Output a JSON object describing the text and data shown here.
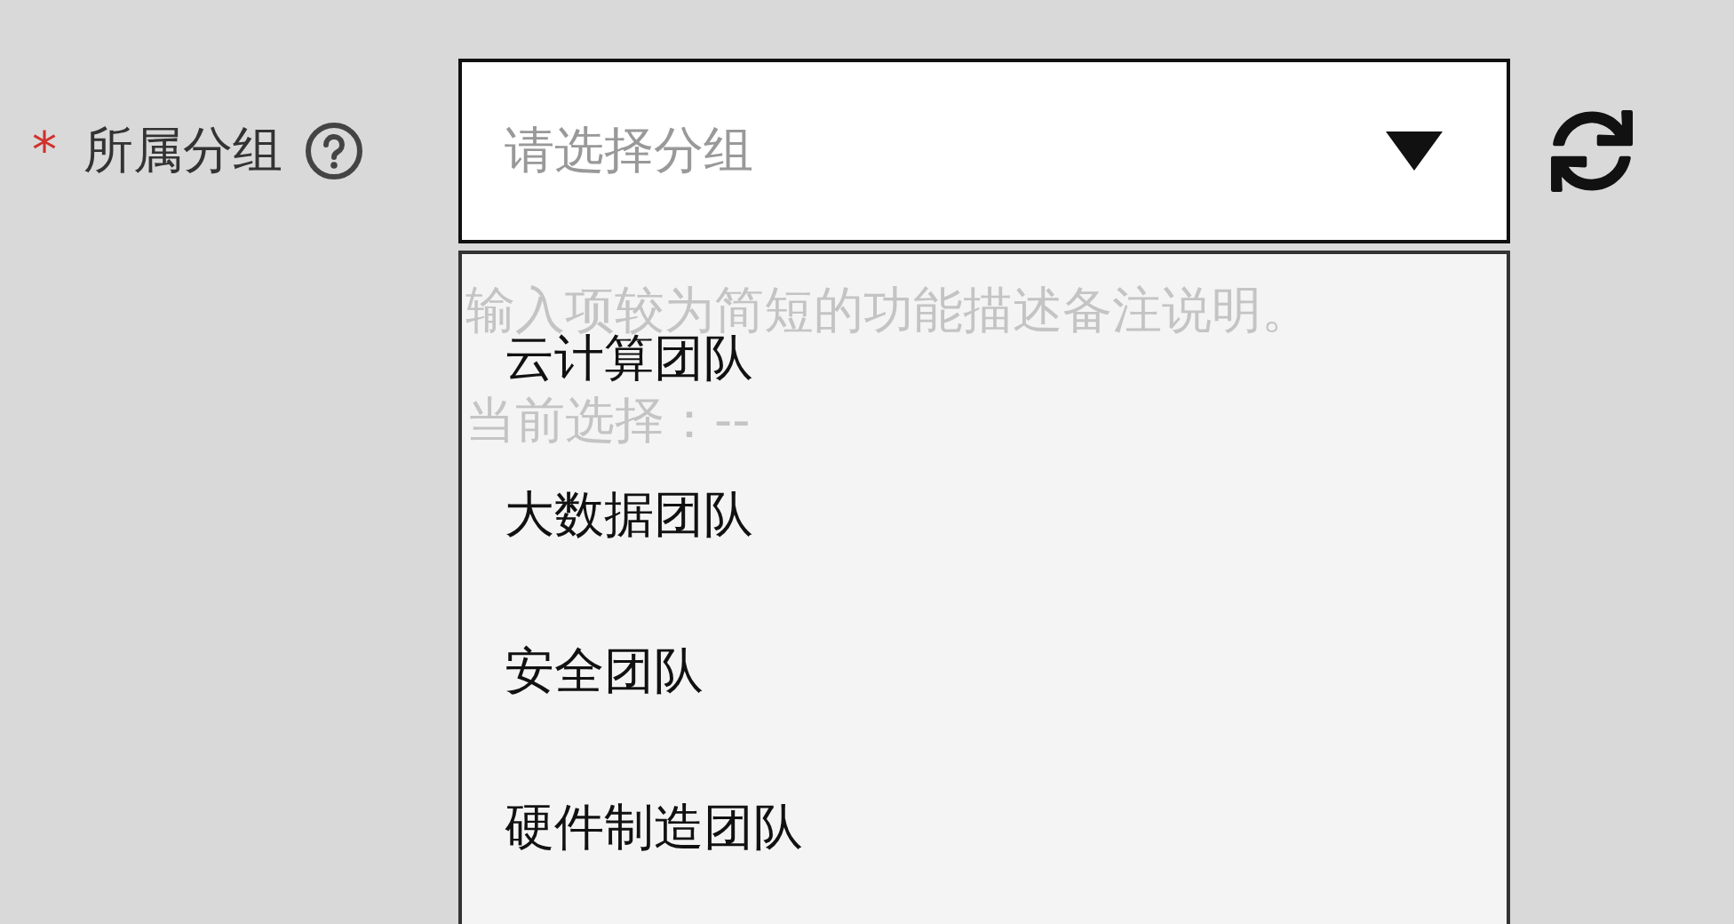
{
  "field": {
    "required": true,
    "required_mark": "*",
    "label": "所属分组",
    "placeholder": "请选择分组",
    "help": "输入项较为简短的功能描述备注说明。",
    "current_label": "当前选择：",
    "current_value": "--",
    "expanded": true
  },
  "options": [
    {
      "label": "云计算团队",
      "selected": false
    },
    {
      "label": "大数据团队",
      "selected": false
    },
    {
      "label": "安全团队",
      "selected": false
    },
    {
      "label": "硬件制造团队",
      "selected": false
    }
  ]
}
